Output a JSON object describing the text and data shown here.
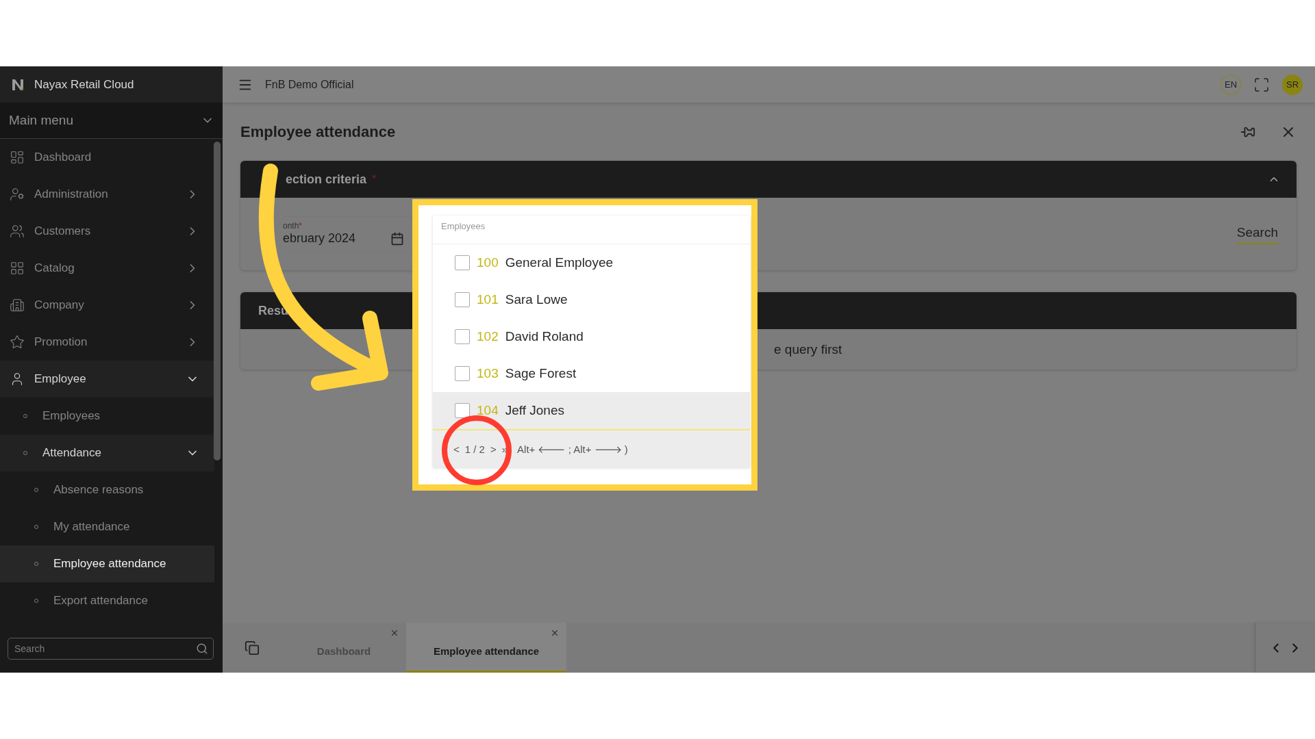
{
  "sidebar": {
    "brand": "Nayax Retail Cloud",
    "menu_title": "Main menu",
    "search": {
      "placeholder": "Search"
    },
    "items": [
      {
        "label": "Dashboard",
        "kind": "link",
        "selected": false
      },
      {
        "label": "Administration",
        "kind": "group",
        "expanded": false,
        "selected": false
      },
      {
        "label": "Customers",
        "kind": "group",
        "expanded": false,
        "selected": false
      },
      {
        "label": "Catalog",
        "kind": "group",
        "expanded": false,
        "selected": false
      },
      {
        "label": "Company",
        "kind": "group",
        "expanded": false,
        "selected": false
      },
      {
        "label": "Promotion",
        "kind": "group",
        "expanded": false,
        "selected": false
      },
      {
        "label": "Employee",
        "kind": "group",
        "expanded": true,
        "selected": false,
        "children": [
          {
            "label": "Employees",
            "kind": "link",
            "selected": false
          },
          {
            "label": "Attendance",
            "kind": "group",
            "expanded": true,
            "selected": false,
            "children": [
              {
                "label": "Absence reasons",
                "kind": "link",
                "selected": false
              },
              {
                "label": "My attendance",
                "kind": "link",
                "selected": false
              },
              {
                "label": "Employee attendance",
                "kind": "link",
                "selected": true
              },
              {
                "label": "Export attendance",
                "kind": "link",
                "selected": false
              }
            ]
          }
        ]
      }
    ]
  },
  "header": {
    "title": "FnB Demo Official",
    "language": "EN",
    "avatar": "SR"
  },
  "page": {
    "title": "Employee attendance",
    "criteria": {
      "title": "ection criteria",
      "required": "*",
      "expanded": true,
      "month_label": "onth",
      "month_required": "*",
      "month_value": "ebruary 2024",
      "search_button": "Search"
    },
    "results": {
      "title": "Resu",
      "message": "e query first"
    }
  },
  "dropdown": {
    "label": "Employees",
    "items": [
      {
        "code": "100",
        "name": "General Employee",
        "checked": false,
        "active": false
      },
      {
        "code": "101",
        "name": "Sara Lowe",
        "checked": false,
        "active": false
      },
      {
        "code": "102",
        "name": "David Roland",
        "checked": false,
        "active": false
      },
      {
        "code": "103",
        "name": "Sage Forest",
        "checked": false,
        "active": false
      },
      {
        "code": "104",
        "name": "Jeff Jones",
        "checked": false,
        "active": true
      }
    ],
    "pagination": {
      "prev": "<",
      "page": "1 / 2",
      "next": ">",
      "last": "»",
      "hint": "Alt+ 🡐 ; Alt+ 🡒 )"
    }
  },
  "tabs": [
    {
      "label": "Dashboard",
      "selected": false
    },
    {
      "label": "Employee attendance",
      "selected": true
    }
  ]
}
